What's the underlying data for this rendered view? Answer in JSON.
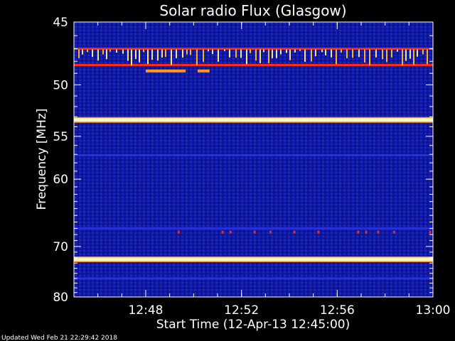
{
  "chart_data": {
    "type": "heatmap",
    "title": "Solar radio Flux (Glasgow)",
    "xlabel": "Start Time (12-Apr-13 12:45:00)",
    "ylabel": "Frequency [MHz]",
    "y_scale": "reciprocal",
    "x_range": [
      "12:45:00",
      "13:00:00"
    ],
    "y_range_mhz": [
      45,
      80
    ],
    "x_ticks": [
      "12:48",
      "12:52",
      "12:56",
      "13:00"
    ],
    "y_ticks": [
      45,
      50,
      55,
      60,
      70,
      80
    ],
    "colors": {
      "background": "#000000",
      "low": "#0a0f9a",
      "mid": "#2530d8",
      "high": "#ff2a10",
      "peak": "#fff8c0"
    },
    "bright_bands_mhz": [
      {
        "freq": 47.0,
        "level": "high"
      },
      {
        "freq": 48.3,
        "level": "high"
      },
      {
        "freq": 53.3,
        "level": "peak"
      },
      {
        "freq": 72.3,
        "level": "peak"
      }
    ],
    "dim_bands_mhz": [
      57.1,
      67.0,
      76.0
    ],
    "footer": "Updated Wed Feb 21 22:29:42 2018"
  }
}
